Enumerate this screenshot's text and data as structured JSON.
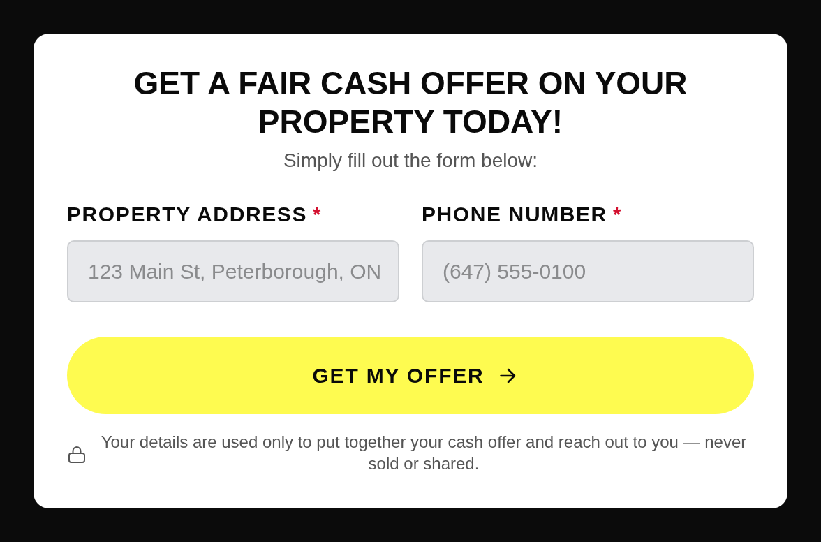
{
  "card": {
    "title": "GET A FAIR CASH OFFER ON YOUR PROPERTY TODAY!",
    "subtitle": "Simply fill out the form below:",
    "fields": [
      {
        "label": "PROPERTY ADDRESS",
        "required_mark": "*",
        "placeholder": "123 Main St, Peterborough, ON"
      },
      {
        "label": "PHONE NUMBER",
        "required_mark": "*",
        "placeholder": "(647) 555-0100"
      }
    ],
    "submit_button": {
      "label": "GET MY OFFER"
    },
    "privacy_note": "Your details are used only to put together your cash offer and reach out to you — never sold or shared."
  }
}
